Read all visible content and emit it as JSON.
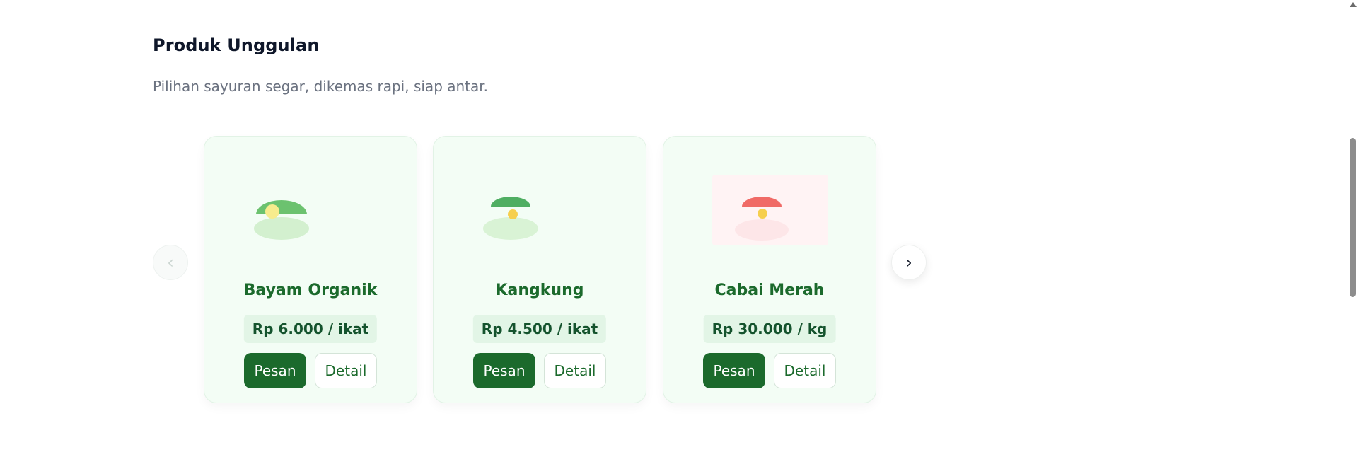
{
  "section": {
    "title": "Produk Unggulan",
    "subtitle": "Pilihan sayuran segar, dikemas rapi, siap antar."
  },
  "carousel": {
    "prev_label": "‹",
    "next_label": "›"
  },
  "products": [
    {
      "name": "Bayam Organik",
      "price": "Rp 6.000 / ikat",
      "order_label": "Pesan",
      "detail_label": "Detail",
      "image_icon": "spinach-icon",
      "colors": {
        "leaf": "#6cc26f",
        "base": "#d3f0cf",
        "dot": "#f7ec8d",
        "bg": "#f3fdf5"
      }
    },
    {
      "name": "Kangkung",
      "price": "Rp 4.500 / ikat",
      "order_label": "Pesan",
      "detail_label": "Detail",
      "image_icon": "water-spinach-icon",
      "colors": {
        "leaf": "#4fae62",
        "base": "#d9f3d5",
        "dot": "#f6cf4d",
        "bg": "#f3fdf5"
      }
    },
    {
      "name": "Cabai Merah",
      "price": "Rp 30.000 / kg",
      "order_label": "Pesan",
      "detail_label": "Detail",
      "image_icon": "red-chili-icon",
      "colors": {
        "leaf": "#f06a66",
        "base": "#fde6e8",
        "dot": "#f6cf4d",
        "bg": "#fff3f4"
      }
    }
  ],
  "theme": {
    "accent": "#1b6a2c",
    "title_color": "#0f172a",
    "subtitle_color": "#6b7280"
  }
}
